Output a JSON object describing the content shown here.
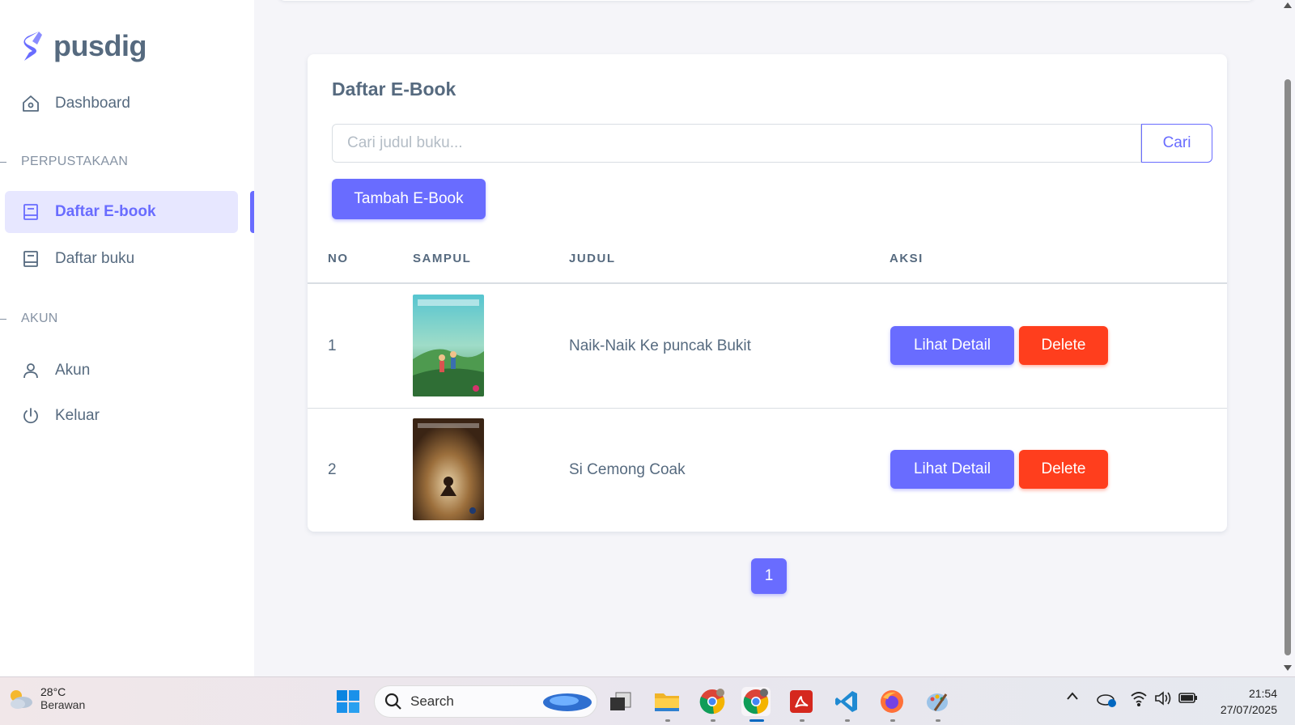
{
  "brand": {
    "name": "pusdig",
    "accent": "#696cff"
  },
  "sidebar": {
    "dashboard": "Dashboard",
    "section_library": "PERPUSTAKAAN",
    "ebook_list": "Daftar E-book",
    "book_list": "Daftar buku",
    "section_account": "AKUN",
    "account": "Akun",
    "logout": "Keluar"
  },
  "card": {
    "title": "Daftar E-Book",
    "search_placeholder": "Cari judul buku...",
    "search_button": "Cari",
    "add_button": "Tambah E-Book",
    "columns": {
      "no": "NO",
      "cover": "SAMPUL",
      "title": "JUDUL",
      "action": "AKSI"
    },
    "rows": [
      {
        "no": "1",
        "title": "Naik-Naik Ke puncak Bukit",
        "detail": "Lihat Detail",
        "delete": "Delete",
        "cover_text": "Naik-Naik"
      },
      {
        "no": "2",
        "title": "Si Cemong Coak",
        "detail": "Lihat Detail",
        "delete": "Delete",
        "cover_text": "Si Cemong Coak"
      }
    ]
  },
  "pagination": {
    "current": "1"
  },
  "taskbar": {
    "weather_temp": "28°C",
    "weather_desc": "Berawan",
    "search_label": "Search",
    "time": "21:54",
    "date": "27/07/2025"
  }
}
